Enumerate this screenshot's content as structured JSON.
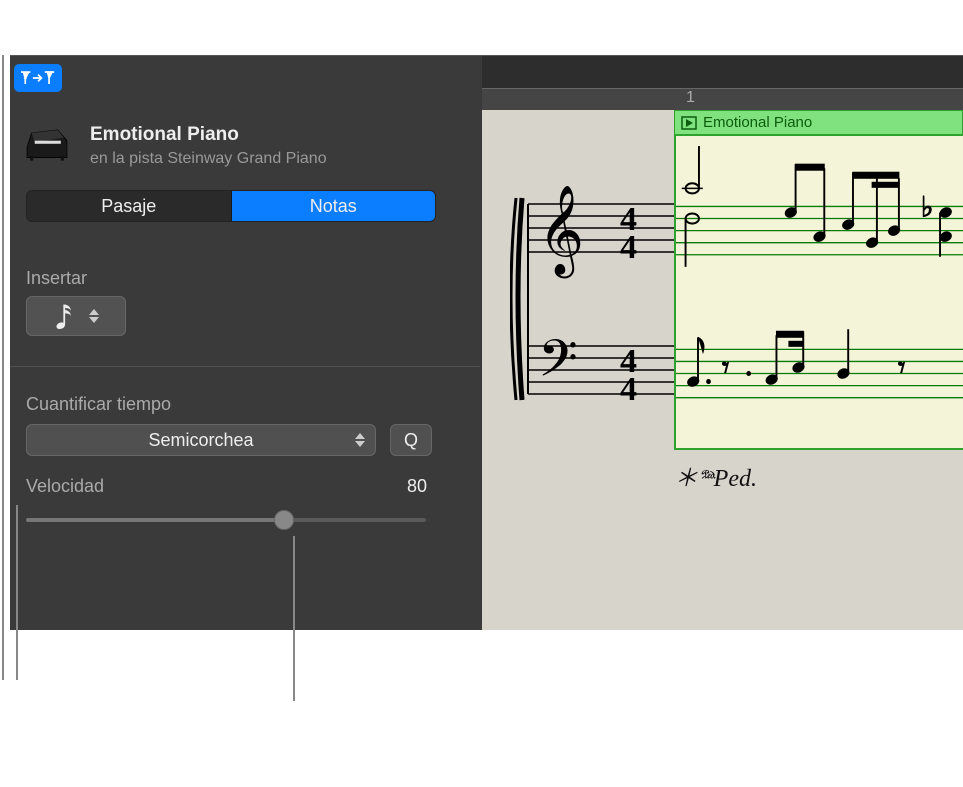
{
  "region": {
    "title": "Emotional Piano",
    "subtitle": "en la pista Steinway Grand Piano"
  },
  "tabs": {
    "passage": "Pasaje",
    "notes": "Notas",
    "active": "notes"
  },
  "insert": {
    "label": "Insertar",
    "value_icon": "sixteenth-note-icon"
  },
  "quantize": {
    "label": "Cuantificar tiempo",
    "value": "Semicorchea",
    "button": "Q"
  },
  "velocity": {
    "label": "Velocidad",
    "value": "80",
    "percent": 63
  },
  "ruler": {
    "bar_number": "1"
  },
  "score_region": {
    "name": "Emotional Piano",
    "pedal_mark": "＊𝆮ed."
  },
  "time_signature": "4/4"
}
